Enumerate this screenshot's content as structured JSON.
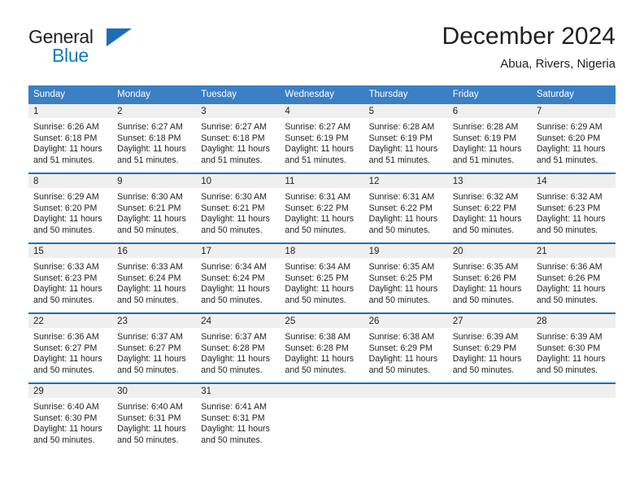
{
  "brand": {
    "name_primary": "General",
    "name_secondary": "Blue"
  },
  "header": {
    "title": "December 2024",
    "subtitle": "Abua, Rivers, Nigeria"
  },
  "colors": {
    "header_blue": "#3b7fc4",
    "rule_blue": "#1b6eb5",
    "logo_blue": "#0f79c8",
    "daynum_band": "#efefef",
    "text": "#231f20"
  },
  "weekday_headers": [
    "Sunday",
    "Monday",
    "Tuesday",
    "Wednesday",
    "Thursday",
    "Friday",
    "Saturday"
  ],
  "weeks": [
    [
      {
        "day": "1",
        "sunrise": "Sunrise: 6:26 AM",
        "sunset": "Sunset: 6:18 PM",
        "daylight": "Daylight: 11 hours and 51 minutes."
      },
      {
        "day": "2",
        "sunrise": "Sunrise: 6:27 AM",
        "sunset": "Sunset: 6:18 PM",
        "daylight": "Daylight: 11 hours and 51 minutes."
      },
      {
        "day": "3",
        "sunrise": "Sunrise: 6:27 AM",
        "sunset": "Sunset: 6:18 PM",
        "daylight": "Daylight: 11 hours and 51 minutes."
      },
      {
        "day": "4",
        "sunrise": "Sunrise: 6:27 AM",
        "sunset": "Sunset: 6:19 PM",
        "daylight": "Daylight: 11 hours and 51 minutes."
      },
      {
        "day": "5",
        "sunrise": "Sunrise: 6:28 AM",
        "sunset": "Sunset: 6:19 PM",
        "daylight": "Daylight: 11 hours and 51 minutes."
      },
      {
        "day": "6",
        "sunrise": "Sunrise: 6:28 AM",
        "sunset": "Sunset: 6:19 PM",
        "daylight": "Daylight: 11 hours and 51 minutes."
      },
      {
        "day": "7",
        "sunrise": "Sunrise: 6:29 AM",
        "sunset": "Sunset: 6:20 PM",
        "daylight": "Daylight: 11 hours and 51 minutes."
      }
    ],
    [
      {
        "day": "8",
        "sunrise": "Sunrise: 6:29 AM",
        "sunset": "Sunset: 6:20 PM",
        "daylight": "Daylight: 11 hours and 50 minutes."
      },
      {
        "day": "9",
        "sunrise": "Sunrise: 6:30 AM",
        "sunset": "Sunset: 6:21 PM",
        "daylight": "Daylight: 11 hours and 50 minutes."
      },
      {
        "day": "10",
        "sunrise": "Sunrise: 6:30 AM",
        "sunset": "Sunset: 6:21 PM",
        "daylight": "Daylight: 11 hours and 50 minutes."
      },
      {
        "day": "11",
        "sunrise": "Sunrise: 6:31 AM",
        "sunset": "Sunset: 6:22 PM",
        "daylight": "Daylight: 11 hours and 50 minutes."
      },
      {
        "day": "12",
        "sunrise": "Sunrise: 6:31 AM",
        "sunset": "Sunset: 6:22 PM",
        "daylight": "Daylight: 11 hours and 50 minutes."
      },
      {
        "day": "13",
        "sunrise": "Sunrise: 6:32 AM",
        "sunset": "Sunset: 6:22 PM",
        "daylight": "Daylight: 11 hours and 50 minutes."
      },
      {
        "day": "14",
        "sunrise": "Sunrise: 6:32 AM",
        "sunset": "Sunset: 6:23 PM",
        "daylight": "Daylight: 11 hours and 50 minutes."
      }
    ],
    [
      {
        "day": "15",
        "sunrise": "Sunrise: 6:33 AM",
        "sunset": "Sunset: 6:23 PM",
        "daylight": "Daylight: 11 hours and 50 minutes."
      },
      {
        "day": "16",
        "sunrise": "Sunrise: 6:33 AM",
        "sunset": "Sunset: 6:24 PM",
        "daylight": "Daylight: 11 hours and 50 minutes."
      },
      {
        "day": "17",
        "sunrise": "Sunrise: 6:34 AM",
        "sunset": "Sunset: 6:24 PM",
        "daylight": "Daylight: 11 hours and 50 minutes."
      },
      {
        "day": "18",
        "sunrise": "Sunrise: 6:34 AM",
        "sunset": "Sunset: 6:25 PM",
        "daylight": "Daylight: 11 hours and 50 minutes."
      },
      {
        "day": "19",
        "sunrise": "Sunrise: 6:35 AM",
        "sunset": "Sunset: 6:25 PM",
        "daylight": "Daylight: 11 hours and 50 minutes."
      },
      {
        "day": "20",
        "sunrise": "Sunrise: 6:35 AM",
        "sunset": "Sunset: 6:26 PM",
        "daylight": "Daylight: 11 hours and 50 minutes."
      },
      {
        "day": "21",
        "sunrise": "Sunrise: 6:36 AM",
        "sunset": "Sunset: 6:26 PM",
        "daylight": "Daylight: 11 hours and 50 minutes."
      }
    ],
    [
      {
        "day": "22",
        "sunrise": "Sunrise: 6:36 AM",
        "sunset": "Sunset: 6:27 PM",
        "daylight": "Daylight: 11 hours and 50 minutes."
      },
      {
        "day": "23",
        "sunrise": "Sunrise: 6:37 AM",
        "sunset": "Sunset: 6:27 PM",
        "daylight": "Daylight: 11 hours and 50 minutes."
      },
      {
        "day": "24",
        "sunrise": "Sunrise: 6:37 AM",
        "sunset": "Sunset: 6:28 PM",
        "daylight": "Daylight: 11 hours and 50 minutes."
      },
      {
        "day": "25",
        "sunrise": "Sunrise: 6:38 AM",
        "sunset": "Sunset: 6:28 PM",
        "daylight": "Daylight: 11 hours and 50 minutes."
      },
      {
        "day": "26",
        "sunrise": "Sunrise: 6:38 AM",
        "sunset": "Sunset: 6:29 PM",
        "daylight": "Daylight: 11 hours and 50 minutes."
      },
      {
        "day": "27",
        "sunrise": "Sunrise: 6:39 AM",
        "sunset": "Sunset: 6:29 PM",
        "daylight": "Daylight: 11 hours and 50 minutes."
      },
      {
        "day": "28",
        "sunrise": "Sunrise: 6:39 AM",
        "sunset": "Sunset: 6:30 PM",
        "daylight": "Daylight: 11 hours and 50 minutes."
      }
    ],
    [
      {
        "day": "29",
        "sunrise": "Sunrise: 6:40 AM",
        "sunset": "Sunset: 6:30 PM",
        "daylight": "Daylight: 11 hours and 50 minutes."
      },
      {
        "day": "30",
        "sunrise": "Sunrise: 6:40 AM",
        "sunset": "Sunset: 6:31 PM",
        "daylight": "Daylight: 11 hours and 50 minutes."
      },
      {
        "day": "31",
        "sunrise": "Sunrise: 6:41 AM",
        "sunset": "Sunset: 6:31 PM",
        "daylight": "Daylight: 11 hours and 50 minutes."
      },
      {
        "day": "",
        "sunrise": "",
        "sunset": "",
        "daylight": ""
      },
      {
        "day": "",
        "sunrise": "",
        "sunset": "",
        "daylight": ""
      },
      {
        "day": "",
        "sunrise": "",
        "sunset": "",
        "daylight": ""
      },
      {
        "day": "",
        "sunrise": "",
        "sunset": "",
        "daylight": ""
      }
    ]
  ]
}
